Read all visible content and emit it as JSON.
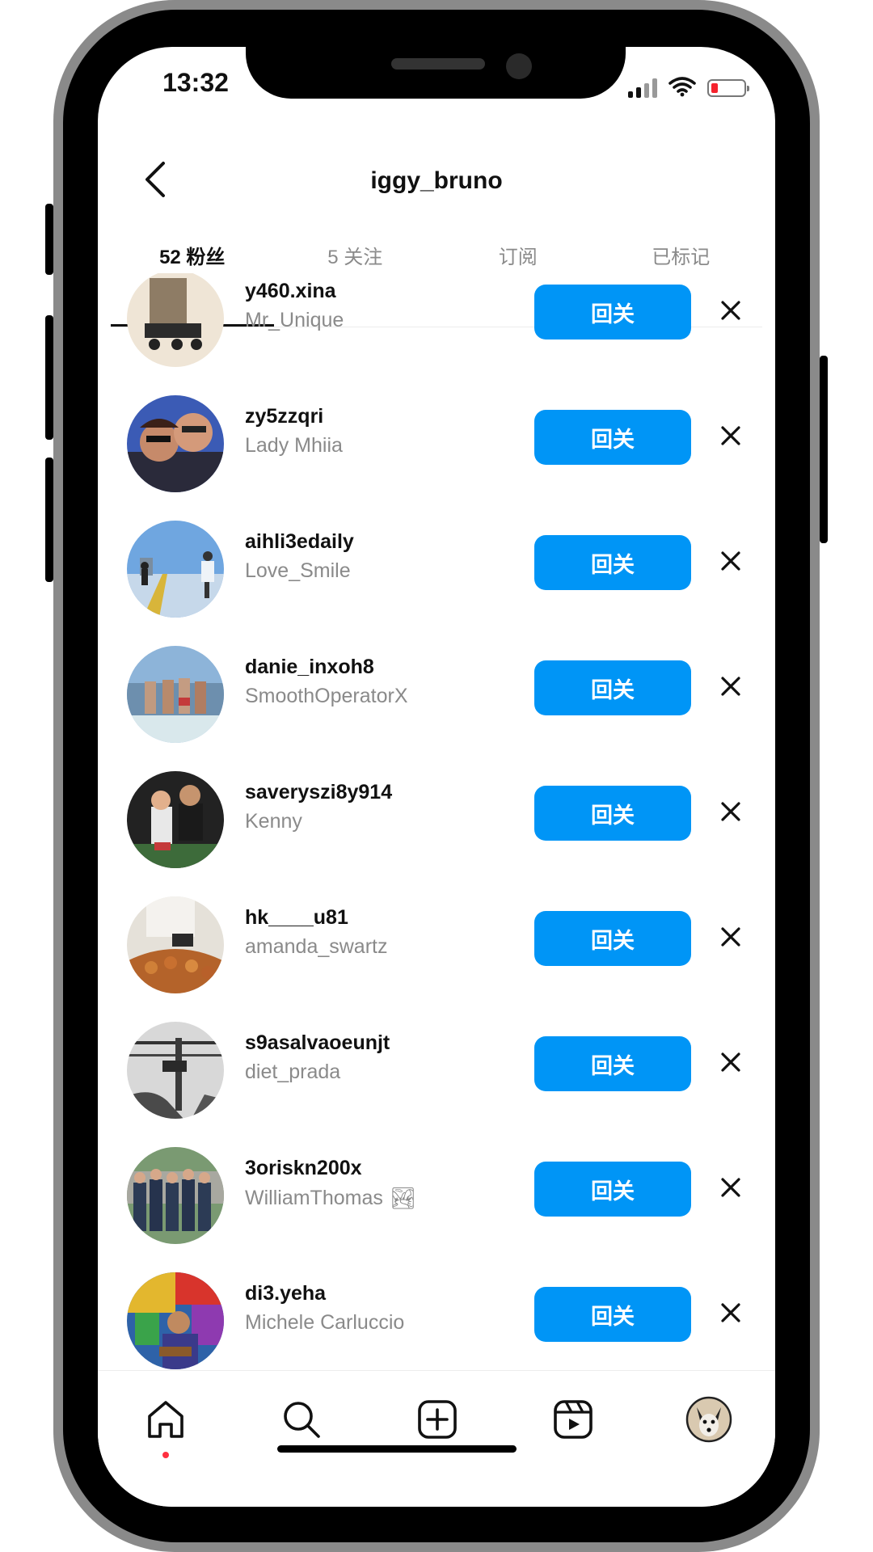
{
  "status_bar": {
    "time": "13:32"
  },
  "header": {
    "title": "iggy_bruno"
  },
  "tabs": [
    {
      "label": "52 粉丝",
      "active": true
    },
    {
      "label": "5 关注",
      "active": false
    },
    {
      "label": "订阅",
      "active": false
    },
    {
      "label": "已标记",
      "active": false
    }
  ],
  "follow_label": "回关",
  "followers": [
    {
      "username": "y460.xina",
      "display_name": "Mr_Unique",
      "avatar_colors": [
        "#efe5d6",
        "#6f5b47"
      ]
    },
    {
      "username": "zy5zzqri",
      "display_name": "Lady Mhiia",
      "avatar_colors": [
        "#3b5bb5",
        "#c68a6a"
      ]
    },
    {
      "username": "aihli3edaily",
      "display_name": "Love_Smile",
      "avatar_colors": [
        "#5e9ad8",
        "#c6d8ea"
      ]
    },
    {
      "username": "danie_inxoh8",
      "display_name": "SmoothOperatorX",
      "avatar_colors": [
        "#8db4d9",
        "#c09a80"
      ]
    },
    {
      "username": "saveryszi8y914",
      "display_name": "Kenny",
      "avatar_colors": [
        "#222222",
        "#3d6b3a"
      ]
    },
    {
      "username": "hk____u81",
      "display_name": "amanda_swartz",
      "avatar_colors": [
        "#e5e1d9",
        "#b4632a"
      ]
    },
    {
      "username": "s9asalvaoeunjt",
      "display_name": "diet_prada",
      "avatar_colors": [
        "#d8d8d8",
        "#4a4a4a"
      ]
    },
    {
      "username": "3oriskn200x",
      "display_name": "WilliamThomas",
      "display_emoji": "🏞",
      "avatar_colors": [
        "#3d5a7a",
        "#2c3b55"
      ]
    },
    {
      "username": "di3.yeha",
      "display_name": "Michele Carluccio",
      "avatar_colors": [
        "#e3b72e",
        "#2e62a8"
      ]
    }
  ],
  "nav": {
    "items": [
      "home-icon",
      "search-icon",
      "create-icon",
      "reels-icon",
      "profile-avatar"
    ],
    "active": "home-icon"
  },
  "colors": {
    "accent": "#0095f6",
    "notification_dot": "#ff3040",
    "battery_low": "#f5222d"
  }
}
